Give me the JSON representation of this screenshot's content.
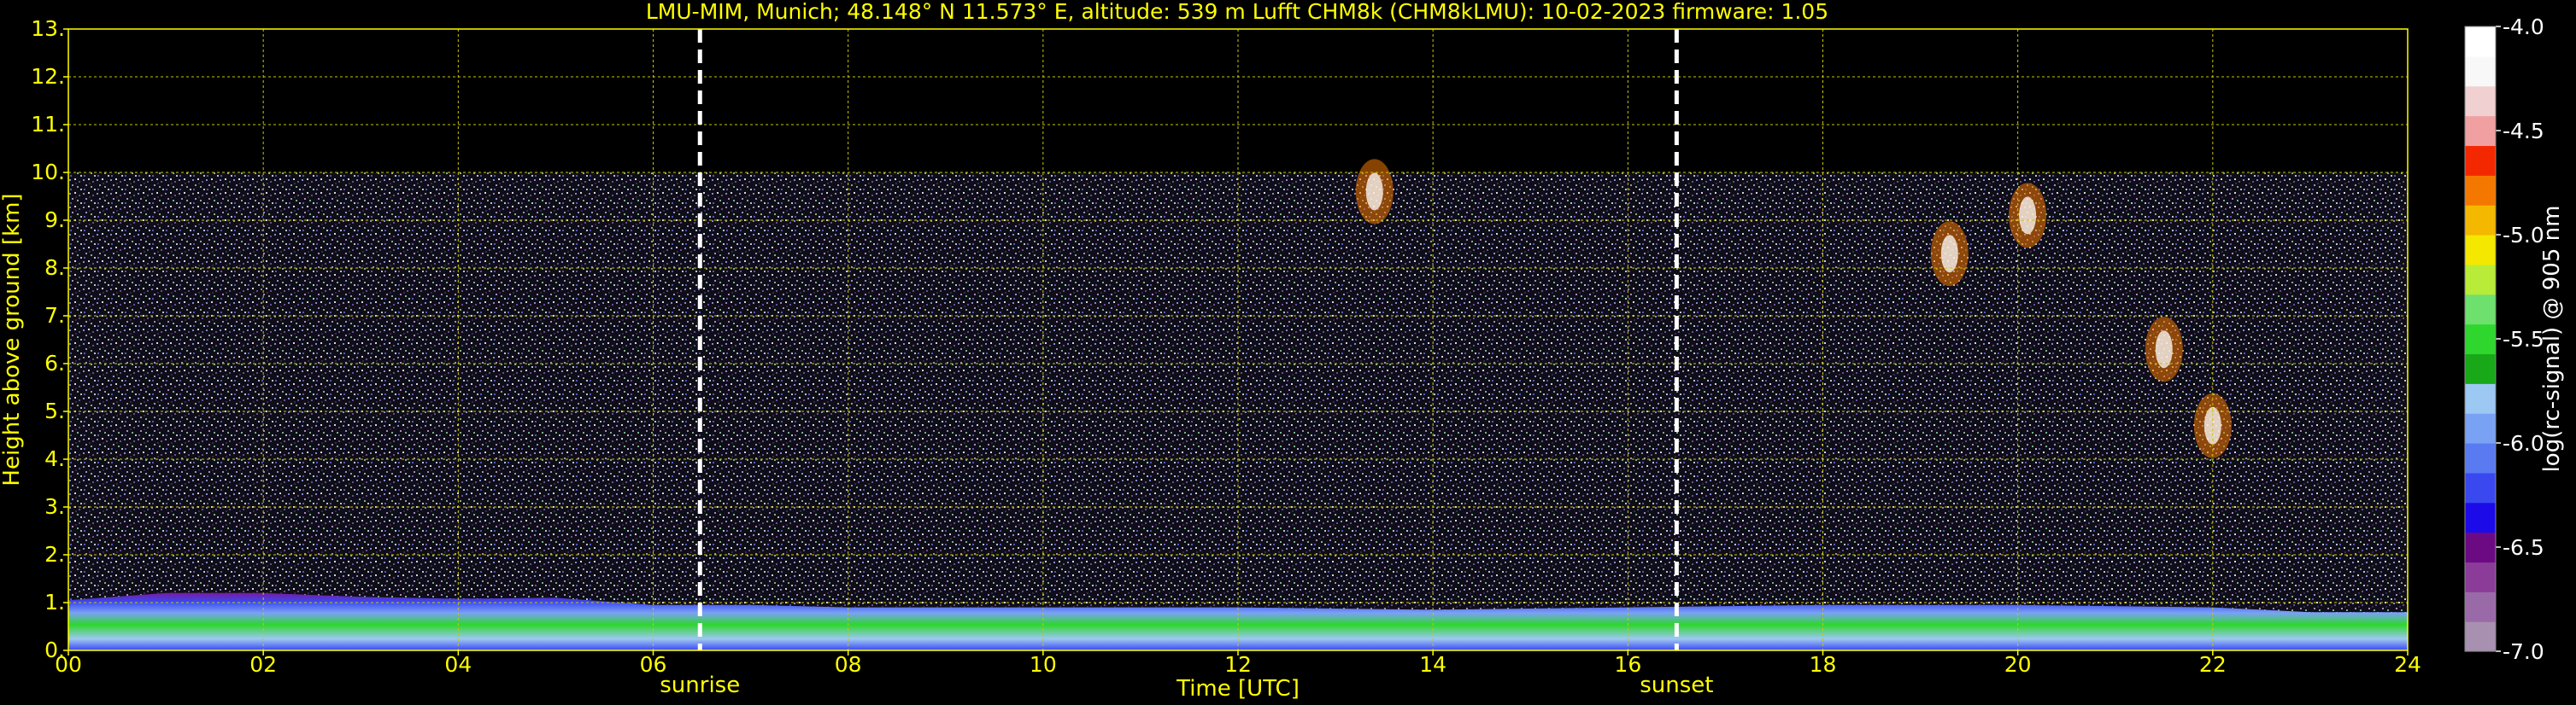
{
  "title": "LMU-MIM, Munich; 48.148° N 11.573° E, altitude: 539 m    Lufft CHM8k (CHM8kLMU): 10-02-2023    firmware: 1.05",
  "chart_data": {
    "type": "heatmap",
    "xlabel": "Time [UTC]",
    "ylabel": "Height above ground [km]",
    "xlim": [
      0,
      24
    ],
    "ylim": [
      0,
      13
    ],
    "xticks": [
      "00",
      "02",
      "04",
      "06",
      "08",
      "10",
      "12",
      "14",
      "16",
      "18",
      "20",
      "22",
      "24"
    ],
    "yticks": [
      "0.",
      "1.",
      "2.",
      "3.",
      "4.",
      "5.",
      "6.",
      "7.",
      "8.",
      "9.",
      "10.",
      "11.",
      "12.",
      "13."
    ],
    "grid": true,
    "data_top_km": 10,
    "boundary_layer_top_km": {
      "time_h": [
        0,
        1,
        2,
        3,
        4,
        5,
        6,
        7,
        8,
        10,
        12,
        14,
        16,
        18,
        20,
        22,
        23,
        24
      ],
      "height_km": [
        1.05,
        1.2,
        1.2,
        1.12,
        1.08,
        1.1,
        0.95,
        0.95,
        0.9,
        0.9,
        0.9,
        0.85,
        0.9,
        0.95,
        0.95,
        0.9,
        0.8,
        0.8
      ]
    },
    "events": [
      {
        "label": "sunrise",
        "time_h": 6.48
      },
      {
        "label": "sunset",
        "time_h": 16.5
      }
    ],
    "cloud_features": [
      {
        "time_h": 19.3,
        "height_km": 8.3
      },
      {
        "time_h": 20.1,
        "height_km": 9.1
      },
      {
        "time_h": 21.5,
        "height_km": 6.3
      },
      {
        "time_h": 22.0,
        "height_km": 4.7
      },
      {
        "time_h": 13.4,
        "height_km": 9.6
      }
    ],
    "colorbar": {
      "label": "log(rc-signal) @ 905 nm",
      "range": [
        -7.0,
        -4.0
      ],
      "ticks": [
        "-4.0",
        "-4.5",
        "-5.0",
        "-5.5",
        "-6.0",
        "-6.5",
        "-7.0"
      ],
      "colors": [
        "#a890b0",
        "#9a6aa8",
        "#8a3c98",
        "#6c0a84",
        "#1c0ae8",
        "#3a48f0",
        "#5a7af2",
        "#7aa2f4",
        "#9ec8f4",
        "#18a818",
        "#2ed62e",
        "#6ee06e",
        "#b8ec38",
        "#f4e800",
        "#f4b800",
        "#f47800",
        "#f42800",
        "#f0a0a0",
        "#f0d0d0",
        "#f8f8f8",
        "#ffffff"
      ]
    }
  }
}
